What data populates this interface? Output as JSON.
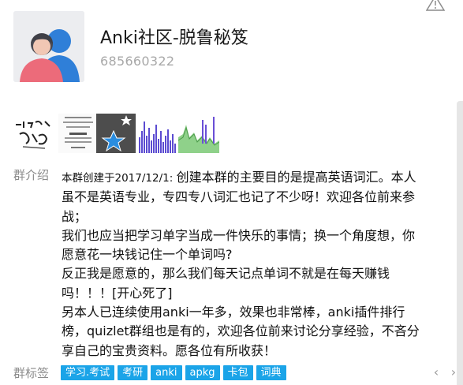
{
  "group": {
    "name": "Anki社区-脱鲁秘笈",
    "id": "685660322"
  },
  "icons": {
    "warning": "warning-triangle-icon",
    "avatar": "default-group-avatar-icon",
    "prev": "chevron-left-icon",
    "next": "chevron-right-icon"
  },
  "colors": {
    "tag_bg": "#1ba4e8",
    "label_gray": "#8b8b8b",
    "id_gray": "#a8a8a8"
  },
  "photos_label": "",
  "intro": {
    "label": "群介绍",
    "prefix": "本群创建于2017/12/1: ",
    "lines": [
      "创建本群的主要目的是提高英语词汇。本人",
      "虽不是英语专业，专四专八词汇也记了不少呀！欢迎各位前来参",
      "战；",
      "我们也应当把学习单字当成一件快乐的事情；换一个角度想，你",
      "愿意花一块钱记住一个单词吗?",
      "反正我是愿意的，那么我们每天记点单词不就是在每天赚钱",
      "吗！！！[开心死了]",
      "另本人已连续使用anki一年多，效果也非常棒，anki插件排行",
      "榜，quizlet群组也是有的，欢迎各位前来讨论分享经验，不吝分",
      "享自己的宝贵资料。愿各位有所收获！"
    ]
  },
  "tags": {
    "label": "群标签",
    "items": [
      "学习.考试",
      "考研",
      "anki",
      "apkg",
      "卡包",
      "词典"
    ]
  },
  "nav": {
    "prev": "‹",
    "next": "›"
  }
}
